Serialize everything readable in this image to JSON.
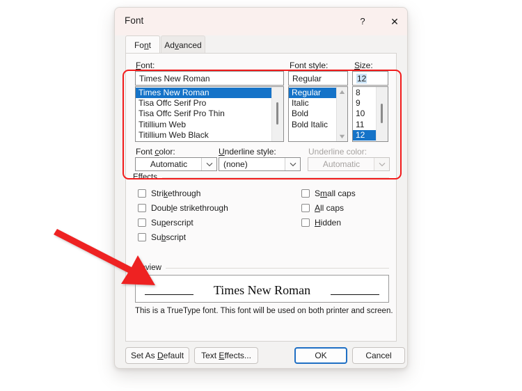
{
  "dialog": {
    "title": "Font",
    "help_icon": "?",
    "close_icon": "✕",
    "tabs": [
      {
        "label": "Font",
        "accel": "n",
        "active": true
      },
      {
        "label": "Advanced",
        "accel": "v",
        "active": false
      }
    ]
  },
  "font_section": {
    "font_label": "Font:",
    "font_label_accel": "F",
    "font_value": "Times New Roman",
    "font_list": [
      {
        "name": "Times New Roman",
        "selected": true
      },
      {
        "name": "Tisa Offc Serif Pro",
        "selected": false
      },
      {
        "name": "Tisa Offc Serif Pro Thin",
        "selected": false
      },
      {
        "name": "Titillium Web",
        "selected": false
      },
      {
        "name": "Titillium Web Black",
        "selected": false
      }
    ],
    "style_label": "Font style:",
    "style_value": "Regular",
    "style_list": [
      {
        "name": "Regular",
        "selected": true
      },
      {
        "name": "Italic",
        "selected": false
      },
      {
        "name": "Bold",
        "selected": false
      },
      {
        "name": "Bold Italic",
        "selected": false
      }
    ],
    "size_label": "Size:",
    "size_label_accel": "S",
    "size_value": "12",
    "size_list": [
      {
        "name": "8",
        "selected": false
      },
      {
        "name": "9",
        "selected": false
      },
      {
        "name": "10",
        "selected": false
      },
      {
        "name": "11",
        "selected": false
      },
      {
        "name": "12",
        "selected": true
      }
    ]
  },
  "color_row": {
    "font_color_label_pre": "Font ",
    "font_color_label_accel": "c",
    "font_color_label_post": "olor:",
    "font_color_value": "Automatic",
    "underline_style_label_accel": "U",
    "underline_style_label_post": "nderline style:",
    "underline_style_value": "(none)",
    "underline_color_label": "Underline color:",
    "underline_color_value": "Automatic",
    "underline_color_disabled": true
  },
  "effects": {
    "group_label": "Effects",
    "left_items": [
      {
        "label_pre": "Stri",
        "accel": "k",
        "label_post": "ethrough",
        "checked": false
      },
      {
        "label_pre": "Doub",
        "accel": "l",
        "label_post": "e strikethrough",
        "checked": false
      },
      {
        "label_pre": "Su",
        "accel": "p",
        "label_post": "erscript",
        "checked": false
      },
      {
        "label_pre": "Su",
        "accel": "b",
        "label_post": "script",
        "checked": false
      }
    ],
    "right_items": [
      {
        "label_pre": "S",
        "accel": "m",
        "label_post": "all caps",
        "checked": false
      },
      {
        "label_pre": "",
        "accel": "A",
        "label_post": "ll caps",
        "checked": false
      },
      {
        "label_pre": "",
        "accel": "H",
        "label_post": "idden",
        "checked": false
      }
    ]
  },
  "preview": {
    "group_label": "Preview",
    "sample_text": "Times New Roman",
    "note": "This is a TrueType font. This font will be used on both printer and screen."
  },
  "buttons": {
    "set_as_default_pre": "Set As ",
    "set_as_default_accel": "D",
    "set_as_default_post": "efault",
    "text_effects_pre": "Text ",
    "text_effects_accel": "E",
    "text_effects_post": "ffects...",
    "ok": "OK",
    "cancel": "Cancel"
  },
  "annotations": {
    "highlight_color": "#f21a1a",
    "arrow_color": "#ee2222",
    "highlight_target": "font-size-style-selection-area",
    "arrow_target": "preview-box"
  }
}
